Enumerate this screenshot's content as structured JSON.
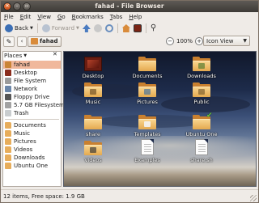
{
  "window": {
    "title": "fahad - File Browser"
  },
  "menubar": {
    "items": [
      "File",
      "Edit",
      "View",
      "Go",
      "Bookmarks",
      "Tabs",
      "Help"
    ]
  },
  "toolbar": {
    "back_label": "Back",
    "forward_label": "Forward",
    "icons": [
      "back-icon",
      "forward-icon",
      "up-icon",
      "stop-icon",
      "reload-icon",
      "home-icon",
      "computer-icon",
      "search-icon"
    ]
  },
  "location": {
    "crumb_label": "fahad",
    "zoom_level": "100%",
    "view_mode": "Icon View"
  },
  "sidebar": {
    "header": "Places",
    "places": [
      {
        "label": "fahad",
        "icon": "home-icon",
        "selected": true
      },
      {
        "label": "Desktop",
        "icon": "desktop-icon"
      },
      {
        "label": "File System",
        "icon": "filesystem-icon"
      },
      {
        "label": "Network",
        "icon": "network-icon"
      },
      {
        "label": "Floppy Drive",
        "icon": "floppy-icon"
      },
      {
        "label": "5.7 GB Filesystem",
        "icon": "disk-icon"
      },
      {
        "label": "Trash",
        "icon": "trash-icon"
      }
    ],
    "bookmarks": [
      {
        "label": "Documents",
        "icon": "folder-icon"
      },
      {
        "label": "Music",
        "icon": "folder-icon"
      },
      {
        "label": "Pictures",
        "icon": "folder-icon"
      },
      {
        "label": "Videos",
        "icon": "folder-icon"
      },
      {
        "label": "Downloads",
        "icon": "folder-icon"
      },
      {
        "label": "Ubuntu One",
        "icon": "folder-icon"
      }
    ]
  },
  "files": [
    {
      "label": "Desktop",
      "icon": "desktop-icon"
    },
    {
      "label": "Documents",
      "icon": "folder-icon"
    },
    {
      "label": "Downloads",
      "icon": "folder-download-icon"
    },
    {
      "label": "Music",
      "icon": "folder-music-icon"
    },
    {
      "label": "Pictures",
      "icon": "folder-pictures-icon"
    },
    {
      "label": "Public",
      "icon": "folder-public-icon"
    },
    {
      "label": "share",
      "icon": "folder-icon"
    },
    {
      "label": "Templates",
      "icon": "folder-templates-icon"
    },
    {
      "label": "Ubuntu One",
      "icon": "folder-ubuntuone-icon"
    },
    {
      "label": "Videos",
      "icon": "folder-videos-icon"
    },
    {
      "label": "Examples",
      "icon": "document-icon"
    },
    {
      "label": "share.sh",
      "icon": "script-icon"
    }
  ],
  "status": {
    "text": "12 items, Free space: 1.9 GB"
  },
  "colors": {
    "selection": "#f0b89c",
    "titlebar": "#3d3a36",
    "window_bg": "#efebe7",
    "folder": "#e4a94f"
  }
}
